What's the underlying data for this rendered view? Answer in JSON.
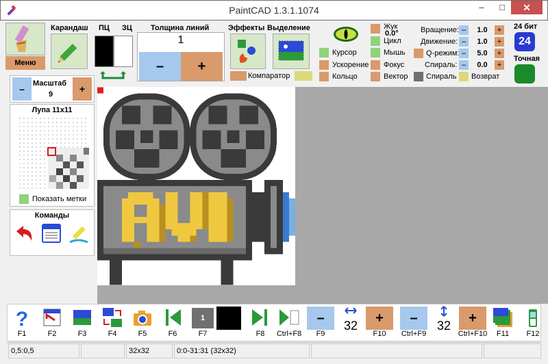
{
  "window": {
    "title": "PaintCAD 1.3.1.1074",
    "minimize": "–",
    "maximize": "□",
    "close": "✕"
  },
  "menu": {
    "label": "Меню"
  },
  "pencil": {
    "label": "Карандаш"
  },
  "colors": {
    "fg_label": "ПЦ",
    "bg_label": "ЗЦ"
  },
  "linewidth": {
    "label": "Толщина линий",
    "value": "1",
    "minus": "–",
    "plus": "+"
  },
  "effects": {
    "label": "Эффекты"
  },
  "selection": {
    "label": "Выделение"
  },
  "comparator": {
    "label": "Компаратор"
  },
  "toggles": {
    "cursor": "Курсор",
    "accel": "Ускорение",
    "ring": "Кольцо",
    "beetle": "Жук",
    "beetle_angle": "0.0°",
    "cycle": "Цикл",
    "mouse": "Мышь",
    "focus": "Фокус",
    "vector": "Вектор"
  },
  "params": {
    "rotation_label": "Вращение:",
    "rotation": "1.0",
    "movement_label": "Движение:",
    "movement": "1.0",
    "qmode_label": "Q-режим:",
    "qmode": "5.0",
    "spiral_label": "Спираль:",
    "spiral": "0.0",
    "spiral2": "Спираль",
    "return": "Возврат"
  },
  "depth": {
    "bits": "24 бит",
    "num": "24",
    "exact": "Точная"
  },
  "scale": {
    "label": "Масштаб",
    "value": "9",
    "minus": "–",
    "plus": "+"
  },
  "magnifier": {
    "title": "Лупа 11x11",
    "show_marks": "Показать метки"
  },
  "commands": {
    "title": "Команды"
  },
  "fkeys": [
    {
      "label": "F1"
    },
    {
      "label": "F2"
    },
    {
      "label": "F3"
    },
    {
      "label": "F4"
    },
    {
      "label": "F5"
    },
    {
      "label": "F6"
    },
    {
      "label": "F7",
      "text": "1"
    },
    {
      "label": "F8"
    },
    {
      "label": "Ctrl+F8"
    },
    {
      "label": "F9"
    },
    {
      "label": "F10"
    },
    {
      "label": "Ctrl+F9"
    },
    {
      "label": "Ctrl+F10"
    },
    {
      "label": "F11"
    },
    {
      "label": "F12"
    }
  ],
  "frame_w": "32",
  "frame_h": "32",
  "status": {
    "coords": "0,5:0,5",
    "size": "32x32",
    "range": "0:0-31:31 (32x32)"
  },
  "accent": {
    "orange": "#d99a6c",
    "blue": "#a6c8ec",
    "green": "#8ed37a"
  }
}
